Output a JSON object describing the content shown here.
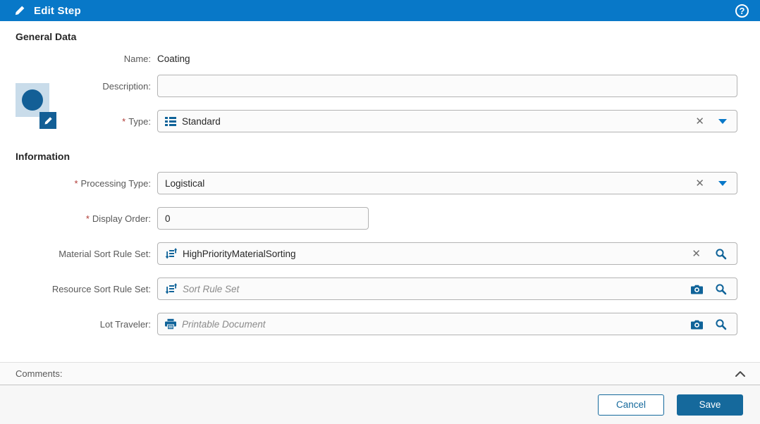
{
  "header": {
    "title": "Edit Step",
    "help_glyph": "?"
  },
  "required_marker": "*",
  "general": {
    "title": "General Data",
    "name_label": "Name:",
    "name_value": "Coating",
    "description_label": "Description:",
    "description_value": "",
    "type_label": "Type:",
    "type_value": "Standard"
  },
  "information": {
    "title": "Information",
    "processing_type_label": "Processing Type:",
    "processing_type_value": "Logistical",
    "display_order_label": "Display Order:",
    "display_order_value": "0",
    "material_sort_label": "Material Sort Rule Set:",
    "material_sort_value": "HighPriorityMaterialSorting",
    "resource_sort_label": "Resource Sort Rule Set:",
    "resource_sort_placeholder": "Sort Rule Set",
    "lot_traveler_label": "Lot Traveler:",
    "lot_traveler_placeholder": "Printable Document"
  },
  "comments": {
    "label": "Comments:"
  },
  "footer": {
    "cancel_label": "Cancel",
    "save_label": "Save"
  },
  "colors": {
    "header_blue": "#0878c8",
    "icon_blue": "#135f96",
    "save_blue": "#15699c",
    "required_red": "#b03a35",
    "tile_light_blue": "#c9dcea"
  }
}
